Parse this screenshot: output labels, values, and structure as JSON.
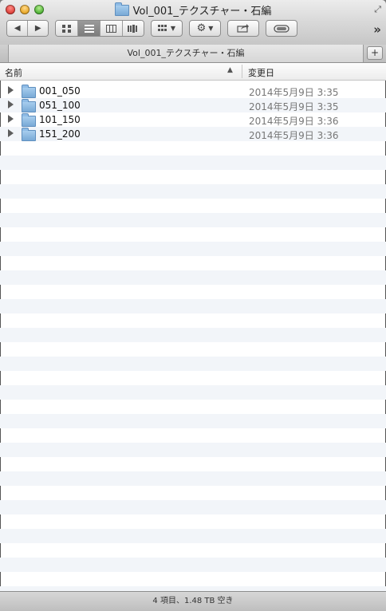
{
  "window": {
    "title": "Vol_001_テクスチャー・石編",
    "tab_title": "Vol_001_テクスチャー・石編"
  },
  "toolbar": {
    "back_icon": "◀",
    "forward_icon": "▶",
    "view_mode_active": "list",
    "overflow_label": "»"
  },
  "tab_add_label": "+",
  "columns": {
    "name": "名前",
    "date_modified": "変更日",
    "sort_indicator": "▲"
  },
  "items": [
    {
      "name": "001_050",
      "date": "2014年5月9日 3:35"
    },
    {
      "name": "051_100",
      "date": "2014年5月9日 3:35"
    },
    {
      "name": "101_150",
      "date": "2014年5月9日 3:36"
    },
    {
      "name": "151_200",
      "date": "2014年5月9日 3:36"
    }
  ],
  "status_bar": {
    "text": "4 項目、1.48 TB 空き"
  }
}
